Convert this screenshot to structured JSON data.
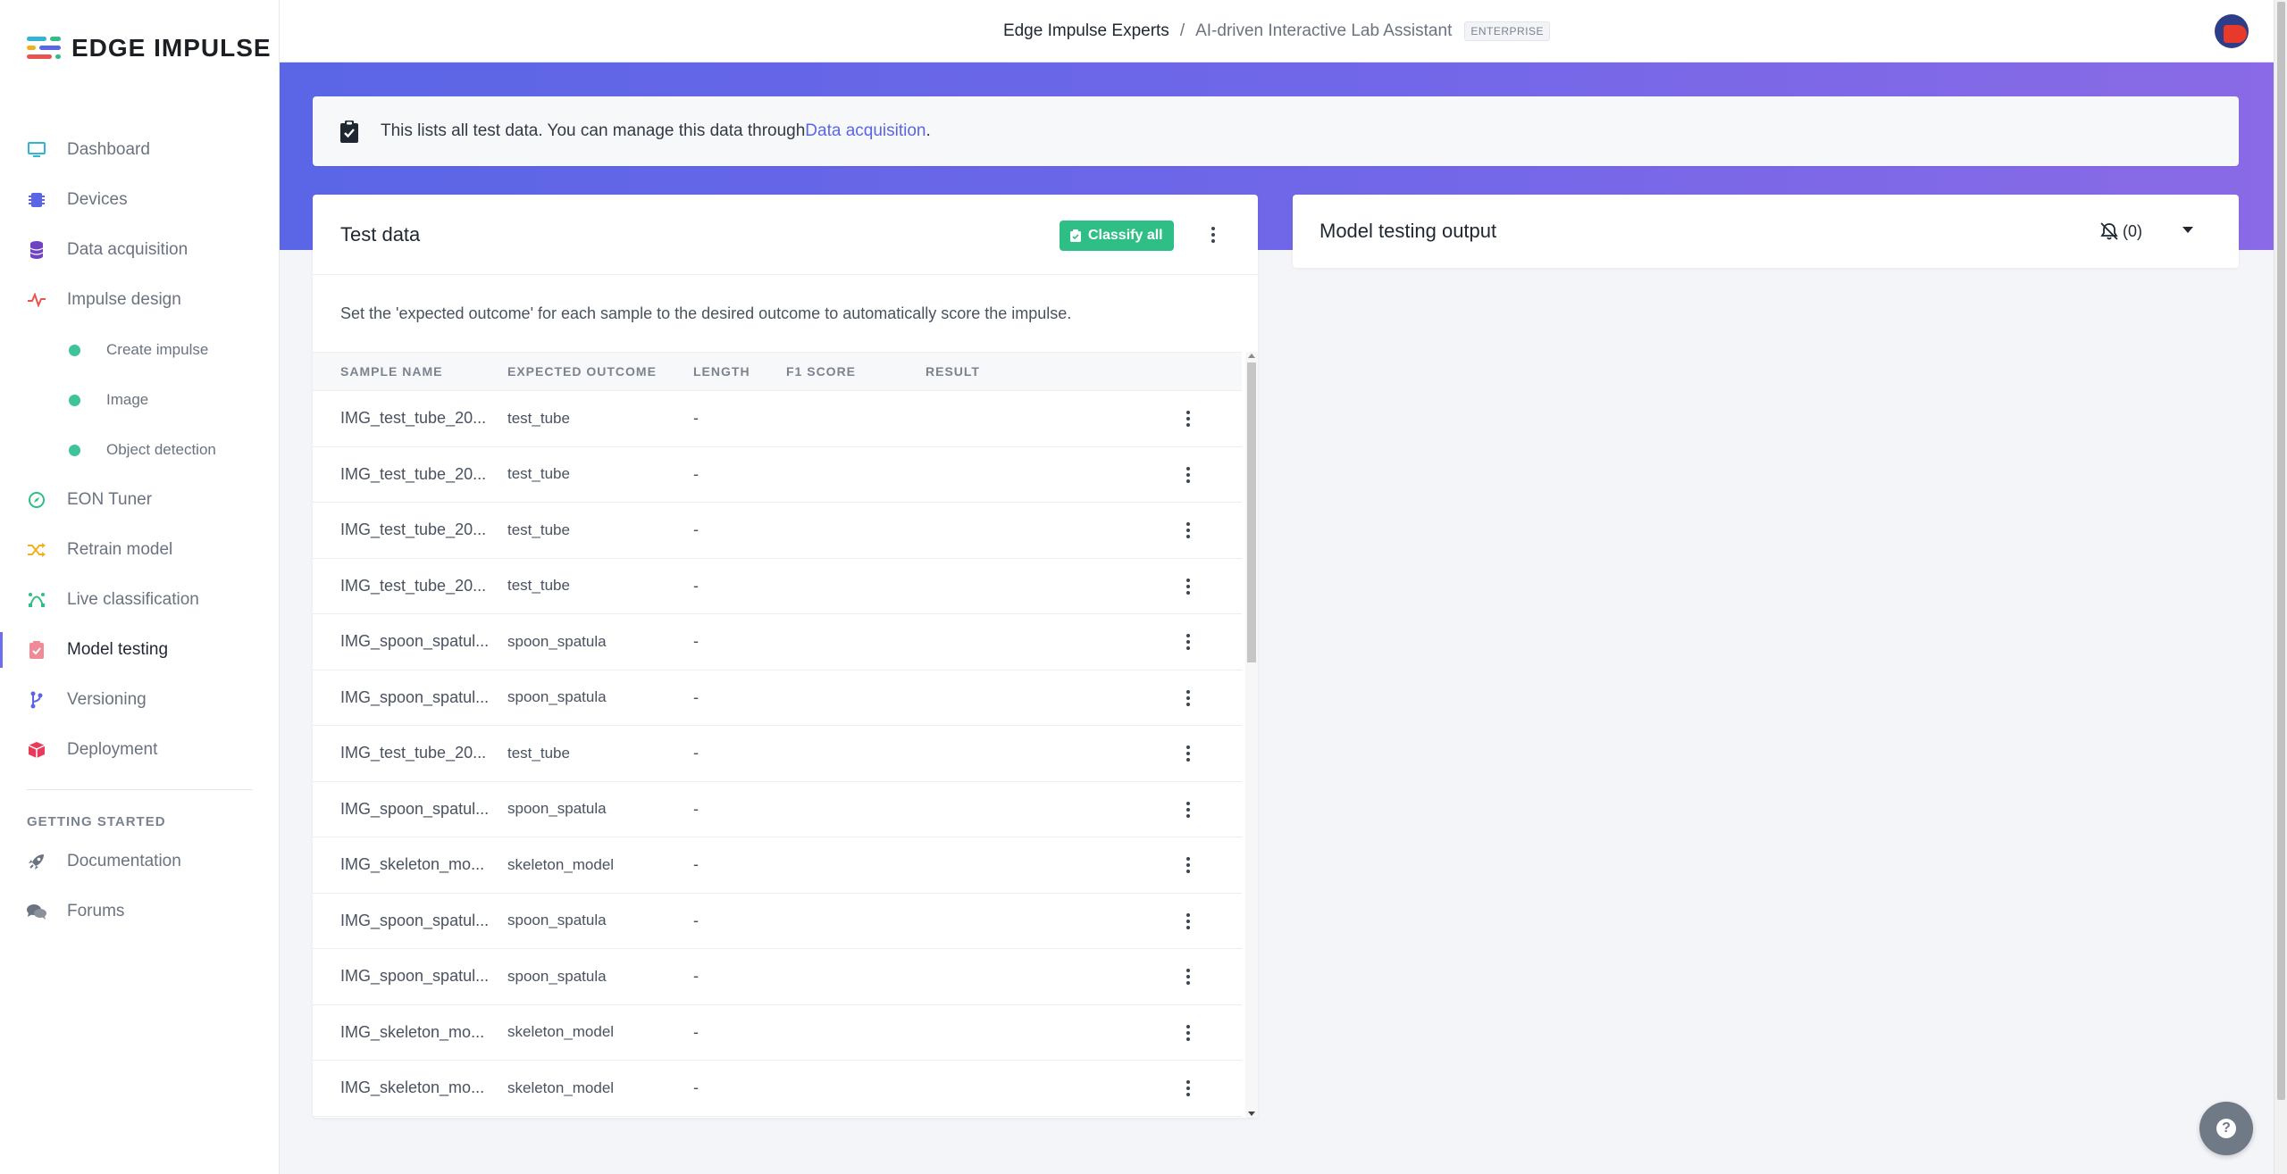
{
  "app": {
    "logo_text": "EDGE IMPULSE"
  },
  "breadcrumb": {
    "organization": "Edge Impulse Experts",
    "separator": "/",
    "project": "AI-driven Interactive Lab Assistant",
    "badge": "ENTERPRISE"
  },
  "sidebar": {
    "items": [
      {
        "label": "Dashboard",
        "icon": "monitor-icon",
        "color": "#32b3d8"
      },
      {
        "label": "Devices",
        "icon": "chip-icon",
        "color": "#5a66e6"
      },
      {
        "label": "Data acquisition",
        "icon": "database-icon",
        "color": "#6e42c1"
      },
      {
        "label": "Impulse design",
        "icon": "pulse-icon",
        "color": "#e8554e"
      },
      {
        "label": "EON Tuner",
        "icon": "compass-icon",
        "color": "#2fbf86"
      },
      {
        "label": "Retrain model",
        "icon": "shuffle-icon",
        "color": "#f2b01e"
      },
      {
        "label": "Live classification",
        "icon": "bezier-icon",
        "color": "#2fbf86"
      },
      {
        "label": "Model testing",
        "icon": "clipboard-check-icon",
        "color": "#f08a96"
      },
      {
        "label": "Versioning",
        "icon": "branch-icon",
        "color": "#5a66e6"
      },
      {
        "label": "Deployment",
        "icon": "cube-icon",
        "color": "#e83a5a"
      }
    ],
    "sub_items": [
      {
        "label": "Create impulse"
      },
      {
        "label": "Image"
      },
      {
        "label": "Object detection"
      }
    ],
    "section_title": "GETTING STARTED",
    "help_items": [
      {
        "label": "Documentation",
        "icon": "rocket-icon"
      },
      {
        "label": "Forums",
        "icon": "comments-icon"
      }
    ]
  },
  "info": {
    "text": "This lists all test data. You can manage this data through ",
    "link": "Data acquisition",
    "suffix": "."
  },
  "test_data": {
    "title": "Test data",
    "classify_label": "Classify all",
    "hint": "Set the 'expected outcome' for each sample to the desired outcome to automatically score the impulse.",
    "columns": [
      "SAMPLE NAME",
      "EXPECTED OUTCOME",
      "LENGTH",
      "F1 SCORE",
      "RESULT"
    ],
    "rows": [
      {
        "name": "IMG_test_tube_20...",
        "expected": "test_tube",
        "length": "-"
      },
      {
        "name": "IMG_test_tube_20...",
        "expected": "test_tube",
        "length": "-"
      },
      {
        "name": "IMG_test_tube_20...",
        "expected": "test_tube",
        "length": "-"
      },
      {
        "name": "IMG_test_tube_20...",
        "expected": "test_tube",
        "length": "-"
      },
      {
        "name": "IMG_spoon_spatul...",
        "expected": "spoon_spatula",
        "length": "-"
      },
      {
        "name": "IMG_spoon_spatul...",
        "expected": "spoon_spatula",
        "length": "-"
      },
      {
        "name": "IMG_test_tube_20...",
        "expected": "test_tube",
        "length": "-"
      },
      {
        "name": "IMG_spoon_spatul...",
        "expected": "spoon_spatula",
        "length": "-"
      },
      {
        "name": "IMG_skeleton_mo...",
        "expected": "skeleton_model",
        "length": "-"
      },
      {
        "name": "IMG_spoon_spatul...",
        "expected": "spoon_spatula",
        "length": "-"
      },
      {
        "name": "IMG_spoon_spatul...",
        "expected": "spoon_spatula",
        "length": "-"
      },
      {
        "name": "IMG_skeleton_mo...",
        "expected": "skeleton_model",
        "length": "-"
      },
      {
        "name": "IMG_skeleton_mo...",
        "expected": "skeleton_model",
        "length": "-"
      }
    ]
  },
  "output": {
    "title": "Model testing output",
    "notifications": "(0)"
  },
  "colors": {
    "accent": "#5a66e6",
    "classify_green": "#2fbf86",
    "band_start": "#5a66e6",
    "band_end": "#8a6ae6"
  }
}
